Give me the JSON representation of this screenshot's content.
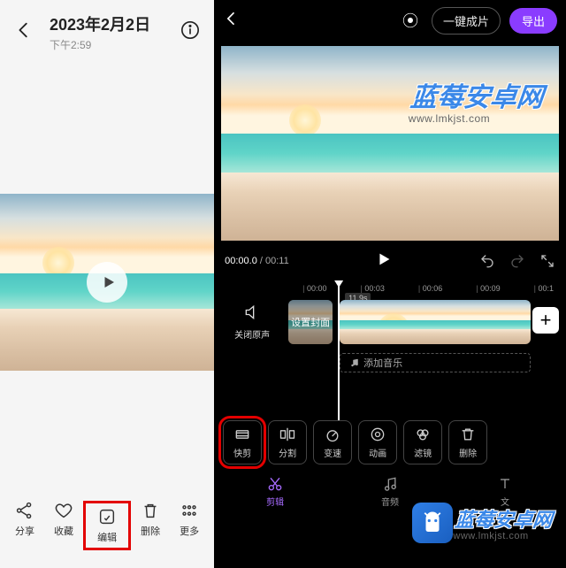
{
  "left": {
    "date": "2023年2月2日",
    "time": "下午2:59",
    "bottom": {
      "share": "分享",
      "favorite": "收藏",
      "edit": "编辑",
      "delete": "删除",
      "more": "更多"
    }
  },
  "right": {
    "oneclick": "一键成片",
    "export": "导出",
    "time_current": "00:00.0",
    "time_total": "00:11",
    "ruler": [
      "00:00",
      "00:03",
      "00:06",
      "00:09",
      "00:1"
    ],
    "close_audio": "关闭原声",
    "set_cover": "设置封面",
    "clip_duration": "11.9s",
    "add_music": "添加音乐",
    "tools": [
      {
        "key": "quickcut",
        "label": "快剪"
      },
      {
        "key": "split",
        "label": "分割"
      },
      {
        "key": "speed",
        "label": "变速"
      },
      {
        "key": "animate",
        "label": "动画"
      },
      {
        "key": "filter",
        "label": "滤镜"
      },
      {
        "key": "delete",
        "label": "删除"
      }
    ],
    "tabs": [
      {
        "key": "clip",
        "label": "剪辑"
      },
      {
        "key": "audio",
        "label": "音频"
      },
      {
        "key": "text",
        "label": "文"
      }
    ]
  },
  "watermark": {
    "brand": "蓝莓安卓网",
    "url": "www.lmkjst.com"
  }
}
